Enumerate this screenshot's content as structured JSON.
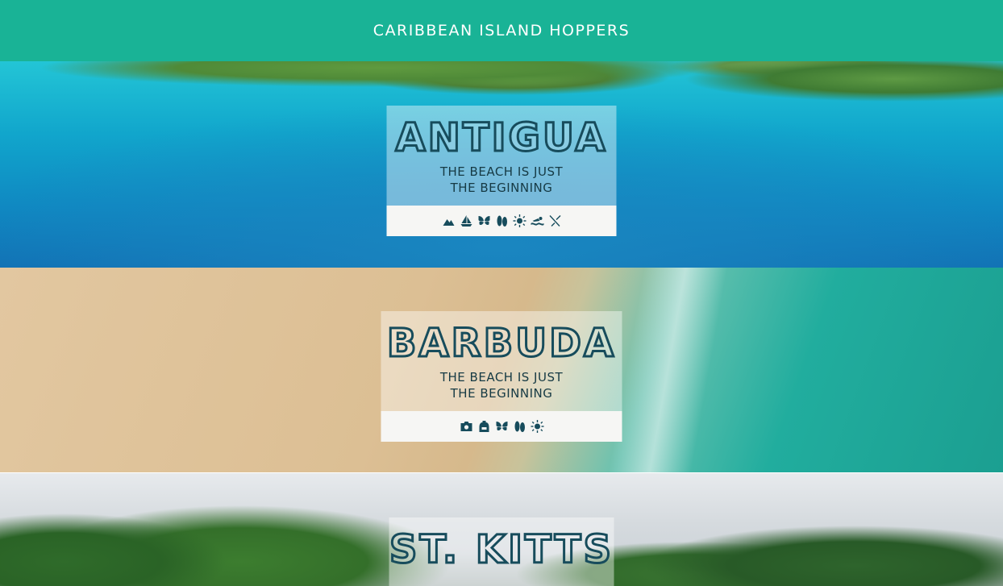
{
  "header": {
    "title": "CARIBBEAN ISLAND HOPPERS"
  },
  "colors": {
    "accent": "#19b396",
    "ink": "#174c5c"
  },
  "islands": [
    {
      "name": "ANTIGUA",
      "tagline_line1": "THE BEACH IS JUST",
      "tagline_line2": "THE BEGINNING",
      "icons": [
        "hiking-icon",
        "sailboat-icon",
        "butterfly-icon",
        "flip-flops-icon",
        "sun-icon",
        "swimming-icon",
        "dining-icon"
      ]
    },
    {
      "name": "BARBUDA",
      "tagline_line1": "THE BEACH IS JUST",
      "tagline_line2": "THE BEGINNING",
      "icons": [
        "camera-icon",
        "backpack-icon",
        "butterfly-icon",
        "flip-flops-icon",
        "sun-icon"
      ]
    },
    {
      "name": "ST. KITTS"
    }
  ]
}
